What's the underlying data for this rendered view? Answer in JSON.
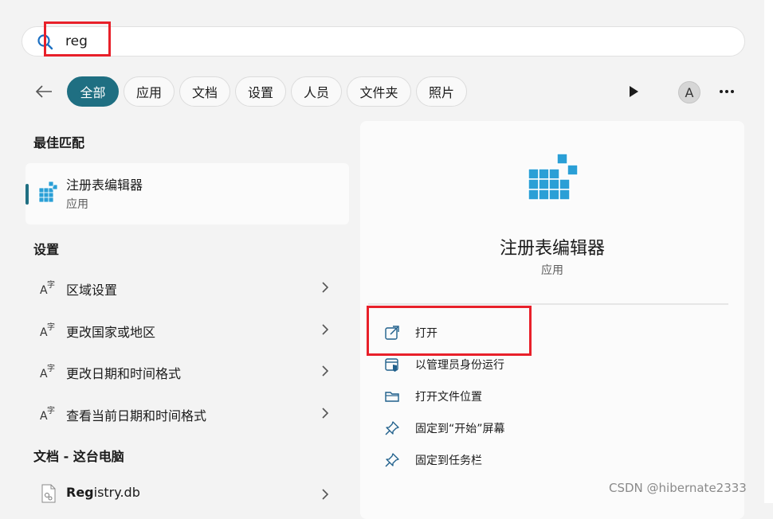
{
  "search": {
    "value": "reg",
    "placeholder": ""
  },
  "filters": {
    "back_icon": "back-arrow-icon",
    "chips": [
      {
        "label": "全部",
        "active": true
      },
      {
        "label": "应用"
      },
      {
        "label": "文档"
      },
      {
        "label": "设置"
      },
      {
        "label": "人员"
      },
      {
        "label": "文件夹"
      },
      {
        "label": "照片"
      }
    ],
    "play_icon": "play-icon",
    "avatar_letter": "A",
    "more_icon": "more-icon"
  },
  "best_match": {
    "section_title": "最佳匹配",
    "name": "注册表编辑器",
    "type": "应用",
    "icon": "registry-editor-icon"
  },
  "settings": {
    "section_title": "设置",
    "items": [
      {
        "label": "区域设置",
        "icon": "language-settings-icon"
      },
      {
        "label": "更改国家或地区",
        "icon": "language-settings-icon"
      },
      {
        "label": "更改日期和时间格式",
        "icon": "language-settings-icon"
      },
      {
        "label": "查看当前日期和时间格式",
        "icon": "language-settings-icon"
      }
    ]
  },
  "documents": {
    "section_title": "文档 - 这台电脑",
    "items": [
      {
        "label_bold": "Reg",
        "label_rest": "istry.db",
        "icon": "file-icon"
      }
    ]
  },
  "preview": {
    "name": "注册表编辑器",
    "type": "应用",
    "actions": [
      {
        "label": "打开",
        "icon": "open-external-icon"
      },
      {
        "label": "以管理员身份运行",
        "icon": "admin-shield-icon"
      },
      {
        "label": "打开文件位置",
        "icon": "folder-icon"
      },
      {
        "label": "固定到“开始”屏幕",
        "icon": "pin-icon"
      },
      {
        "label": "固定到任务栏",
        "icon": "pin-icon"
      }
    ]
  },
  "watermark": "CSDN @hibernate2333",
  "colors": {
    "accent": "#1f6f82",
    "highlight_box": "#e8202a",
    "panel": "#fbfbfb",
    "background": "#f3f3f3"
  }
}
